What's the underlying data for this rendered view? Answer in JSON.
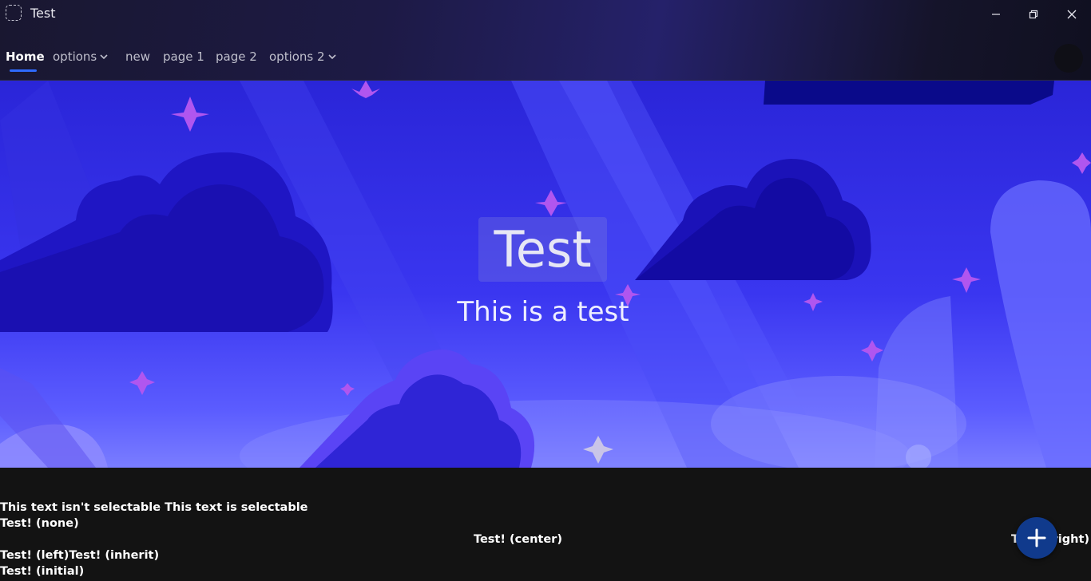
{
  "window": {
    "title": "Test",
    "icon": "app-placeholder-icon",
    "controls": [
      "minimize-icon",
      "restore-icon",
      "close-icon"
    ]
  },
  "nav": {
    "items": [
      {
        "label": "Home",
        "active": true
      },
      {
        "label": "options",
        "dropdown": true
      },
      {
        "label": "new"
      },
      {
        "label": "page 1"
      },
      {
        "label": "page 2"
      },
      {
        "label": "options 2",
        "dropdown": true
      }
    ],
    "accent_color": "#2f6bff"
  },
  "hero": {
    "title": "Test",
    "subtitle": "This is a test"
  },
  "content": {
    "not_selectable": "This text isn't selectable",
    "selectable": "This text is selectable",
    "none": "Test! (none)",
    "left": "Test! (left)",
    "inherit": "Test! (inherit)",
    "initial": "Test! (initial)",
    "center": "Test! (center)",
    "right": "Test! (right)"
  },
  "fab": {
    "icon": "plus-icon",
    "color": "#103a8c"
  }
}
